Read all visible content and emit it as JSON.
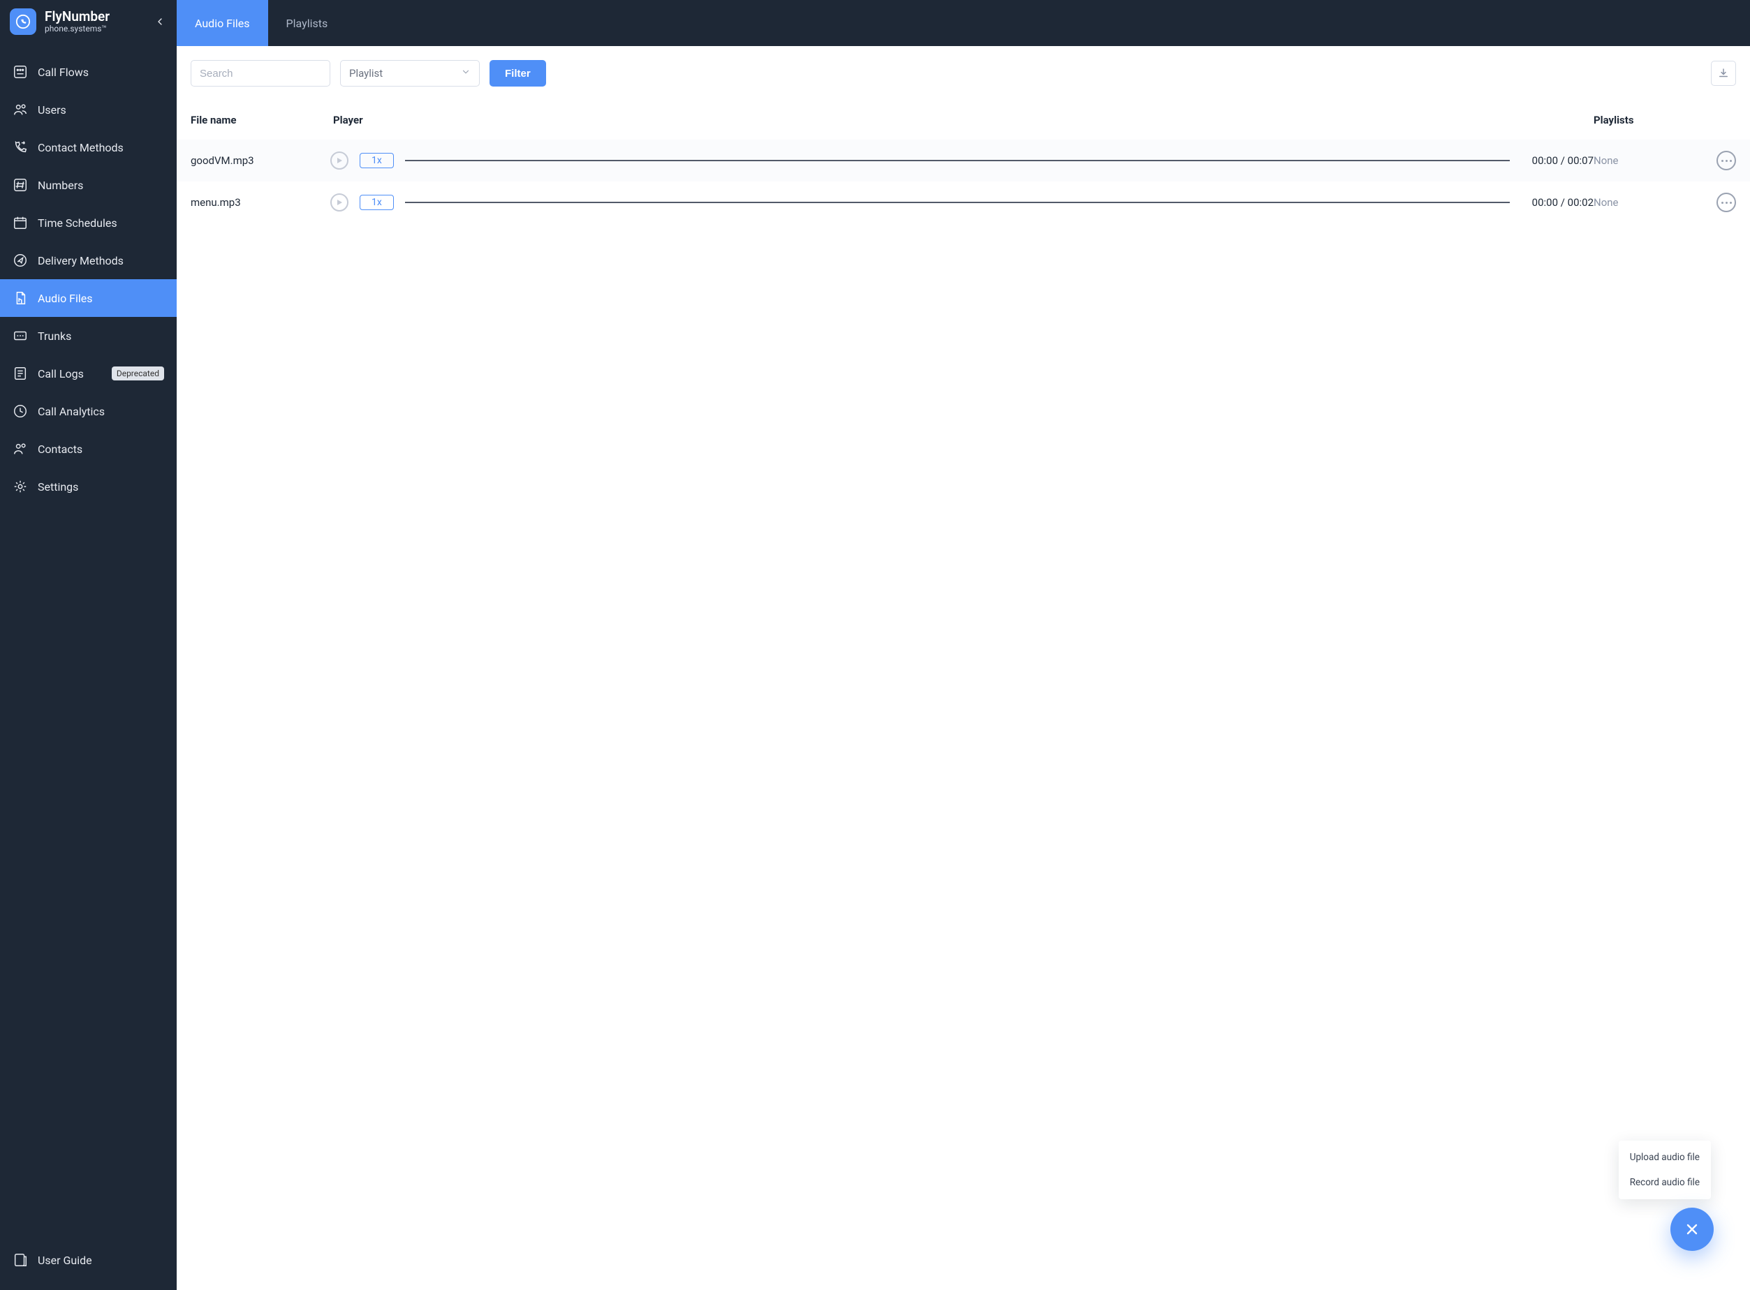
{
  "brand": {
    "title": "FlyNumber",
    "subtitle": "phone.systems™"
  },
  "sidebar": {
    "items": [
      {
        "label": "Call Flows"
      },
      {
        "label": "Users"
      },
      {
        "label": "Contact Methods"
      },
      {
        "label": "Numbers"
      },
      {
        "label": "Time Schedules"
      },
      {
        "label": "Delivery Methods"
      },
      {
        "label": "Audio Files"
      },
      {
        "label": "Trunks"
      },
      {
        "label": "Call Logs",
        "badge": "Deprecated"
      },
      {
        "label": "Call Analytics"
      },
      {
        "label": "Contacts"
      },
      {
        "label": "Settings"
      }
    ],
    "footer": {
      "label": "User Guide"
    }
  },
  "tabs": [
    {
      "label": "Audio Files",
      "active": true
    },
    {
      "label": "Playlists",
      "active": false
    }
  ],
  "toolbar": {
    "search_placeholder": "Search",
    "playlist_selected": "Playlist",
    "filter_label": "Filter"
  },
  "table": {
    "headers": {
      "file_name": "File name",
      "player": "Player",
      "playlists": "Playlists"
    },
    "rows": [
      {
        "file_name": "goodVM.mp3",
        "speed": "1x",
        "time": "00:00 / 00:07",
        "playlist": "None"
      },
      {
        "file_name": "menu.mp3",
        "speed": "1x",
        "time": "00:00 / 00:02",
        "playlist": "None"
      }
    ]
  },
  "popup": {
    "items": [
      {
        "label": "Upload audio file"
      },
      {
        "label": "Record audio file"
      }
    ]
  }
}
